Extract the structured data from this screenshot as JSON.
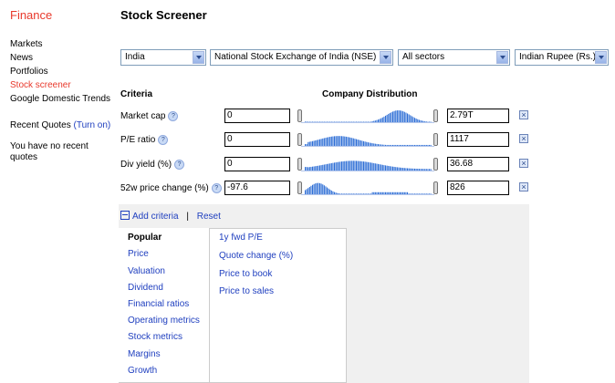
{
  "brand": "Finance",
  "page_title": "Stock Screener",
  "nav": [
    "Markets",
    "News",
    "Portfolios",
    "Stock screener",
    "Google Domestic Trends"
  ],
  "recent": {
    "label": "Recent Quotes",
    "toggle": "(Turn on)",
    "empty": "You have no recent quotes"
  },
  "filters": {
    "country": "India",
    "exchange": "National Stock Exchange of India (NSE)",
    "sector": "All sectors",
    "currency": "Indian Rupee (Rs.)"
  },
  "headers": {
    "criteria": "Criteria",
    "distribution": "Company Distribution"
  },
  "criteria": [
    {
      "label": "Market cap",
      "min": "0",
      "max": "2.79T"
    },
    {
      "label": "P/E ratio",
      "min": "0",
      "max": "1117"
    },
    {
      "label": "Div yield (%)",
      "min": "0",
      "max": "36.68"
    },
    {
      "label": "52w price change (%)",
      "min": "-97.6",
      "max": "826"
    }
  ],
  "actions": {
    "add": "Add criteria",
    "sep": "|",
    "reset": "Reset"
  },
  "tabs": [
    "Popular",
    "Price",
    "Valuation",
    "Dividend",
    "Financial ratios",
    "Operating metrics",
    "Stock metrics",
    "Margins",
    "Growth"
  ],
  "options": [
    "1y fwd P/E",
    "Quote change (%)",
    "Price to book",
    "Price to sales"
  ],
  "colors": {
    "accent": "#e8392c",
    "link": "#1f3fbf",
    "histogram": "#2f6fd6"
  }
}
